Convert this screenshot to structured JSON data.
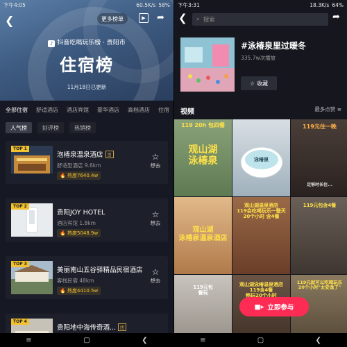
{
  "left": {
    "status": {
      "time": "下午4:05",
      "net": "60.5K/s",
      "battery": "58%"
    },
    "header": {
      "more_lists": "更多榜单",
      "brand": "抖音吃喝玩乐榜 · 贵阳市",
      "title": "住宿榜",
      "updated": "11月18日已更新"
    },
    "categories": [
      "全部住宿",
      "舒适酒店",
      "酒店宾馆",
      "豪华酒店",
      "高档酒店",
      "住宿"
    ],
    "chips": [
      "人气榜",
      "好评榜",
      "热销榜"
    ],
    "cards": [
      {
        "rank": "TOP 1",
        "name": "泡椿泉温泉酒店",
        "badge": "团",
        "sub": "舒适型酒店  9.6km",
        "heat": "热度7640.4w",
        "want": "想去"
      },
      {
        "rank": "TOP 2",
        "name": "贵阳JOY HOTEL",
        "badge": "",
        "sub": "酒店宾馆  1.8km",
        "heat": "热度5048.9w",
        "want": "想去"
      },
      {
        "rank": "TOP 3",
        "name": "美丽南山五谷驿精品民宿酒店",
        "badge": "",
        "sub": "客栈民宿  48km",
        "heat": "热度4410.5w",
        "want": "想去"
      },
      {
        "rank": "TOP 4",
        "name": "贵阳地中海传奇酒...",
        "badge": "团",
        "sub": "",
        "heat": "",
        "want": ""
      }
    ]
  },
  "right": {
    "status": {
      "time": "下午3:31",
      "net": "18.3K/s",
      "battery": "64%"
    },
    "search_placeholder": "搜索",
    "topic": {
      "title": "#泳椿泉里过暖冬",
      "plays": "335.7w次播放",
      "collect": "收藏"
    },
    "videos_label": "视频",
    "sort_label": "最多点赞",
    "tiles": [
      {
        "caption": "119 20h 包四餐",
        "caption2": "观山湖\n泳椿泉",
        "bg": "#7c9a6a"
      },
      {
        "caption": "",
        "caption2": "泳椿泉",
        "bg": "#d8dfe4"
      },
      {
        "caption": "119元住一晚",
        "caption2": "足够时长住...",
        "bg": "#3a3230"
      },
      {
        "caption": "",
        "caption2": "观山湖\n泳椿泉温泉酒店",
        "bg": "#c9a27a"
      },
      {
        "caption": "观山湖温泉酒店\n119会吃喝玩乐一整天\n20个小时 含4餐",
        "caption2": "",
        "bg": "#8a5a3c"
      },
      {
        "caption": "119元包含4餐",
        "caption2": "",
        "bg": "#5a5048"
      },
      {
        "caption": "119元包\n餐玩",
        "caption2": "",
        "bg": "#b9b4ad"
      },
      {
        "caption": "观山湖泳椿温泉酒店\n119含4餐\n畅玩20个小时",
        "caption2": "",
        "bg": "#574538"
      },
      {
        "caption": "119元就可以吃喝玩乐\n20个小时\"太安逸了\"",
        "caption2": "",
        "bg": "#7a6a52"
      }
    ],
    "join": "立即参与"
  }
}
